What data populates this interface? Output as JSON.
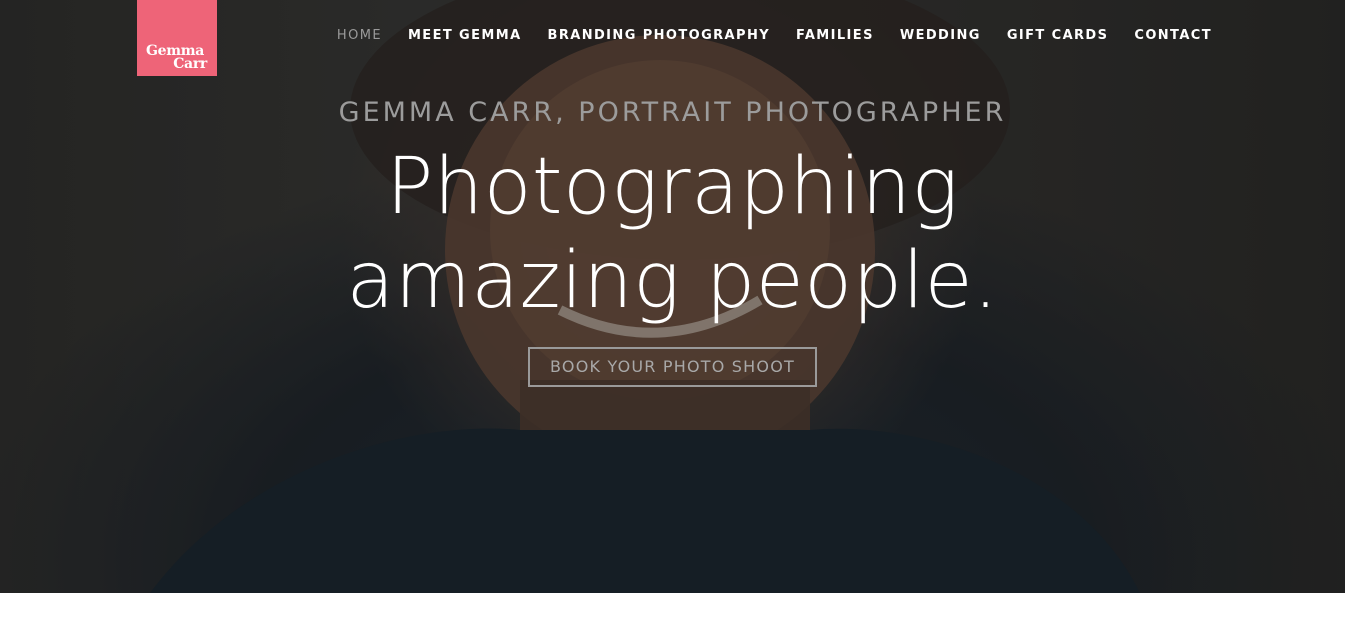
{
  "brand": {
    "line1": "Gemma",
    "line2": "Carr",
    "color": "#ee6478"
  },
  "nav": {
    "items": [
      {
        "label": "HOME",
        "active": true
      },
      {
        "label": "MEET GEMMA"
      },
      {
        "label": "BRANDING PHOTOGRAPHY"
      },
      {
        "label": "FAMILIES"
      },
      {
        "label": "WEDDING"
      },
      {
        "label": "GIFT CARDS"
      },
      {
        "label": "CONTACT"
      }
    ]
  },
  "hero": {
    "subtitle": "GEMMA CARR, PORTRAIT PHOTOGRAPHER",
    "headline_line1": "Photographing",
    "headline_line2": "amazing people.",
    "cta_label": "BOOK YOUR PHOTO SHOOT",
    "background_image": "portrait of a smiling woman"
  }
}
